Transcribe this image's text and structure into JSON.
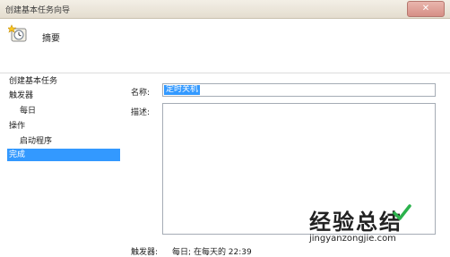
{
  "window": {
    "title": "创建基本任务向导",
    "close_glyph": "✕"
  },
  "header": {
    "icon": "wizard-clock-icon",
    "title": "摘要"
  },
  "steps": [
    {
      "label": "创建基本任务",
      "level": 0,
      "active": false
    },
    {
      "label": "触发器",
      "level": 0,
      "active": false
    },
    {
      "label": "每日",
      "level": 1,
      "active": false
    },
    {
      "label": "操作",
      "level": 0,
      "active": false
    },
    {
      "label": "启动程序",
      "level": 1,
      "active": false
    },
    {
      "label": "完成",
      "level": 0,
      "active": true
    }
  ],
  "form": {
    "name_label": "名称:",
    "name_value": "定时关机",
    "description_label": "描述:",
    "trigger_label": "触发器:",
    "trigger_value": "每日; 在每天的 22:39"
  },
  "watermark": {
    "title": "经验总结",
    "url": "jingyanzongjie.com"
  },
  "colors": {
    "selection": "#3399ff",
    "watermark_accent": "#2bb24c"
  }
}
